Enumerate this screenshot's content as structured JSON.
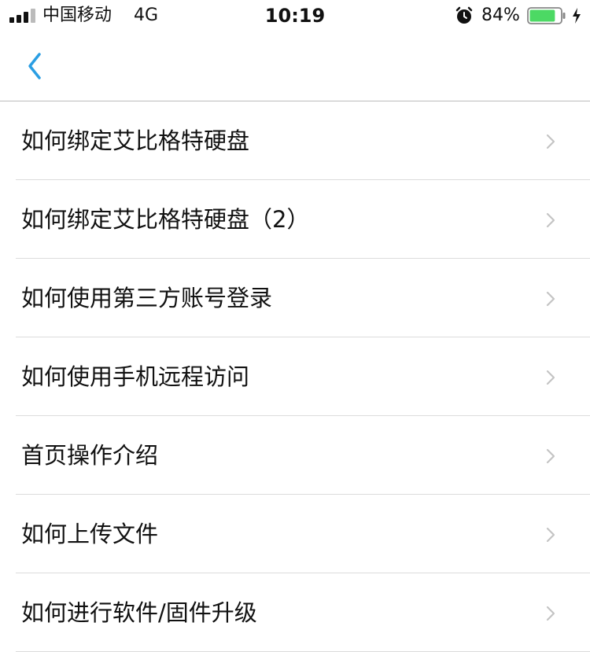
{
  "status_bar": {
    "carrier": "中国移动",
    "network": "4G",
    "time": "10:19",
    "battery_percent": "84%",
    "battery_level": 0.84,
    "battery_color": "#4cd964",
    "icons": [
      "signal-icon",
      "alarm-icon",
      "battery-icon",
      "charging-bolt-icon"
    ]
  },
  "nav": {
    "back_icon": "chevron-left-icon",
    "accent_color": "#2a9ee3"
  },
  "list": {
    "items": [
      {
        "label": "如何绑定艾比格特硬盘"
      },
      {
        "label": "如何绑定艾比格特硬盘（2）"
      },
      {
        "label": "如何使用第三方账号登录"
      },
      {
        "label": "如何使用手机远程访问"
      },
      {
        "label": "首页操作介绍"
      },
      {
        "label": "如何上传文件"
      },
      {
        "label": "如何进行软件/固件升级"
      }
    ],
    "row_icon": "chevron-right-icon"
  }
}
